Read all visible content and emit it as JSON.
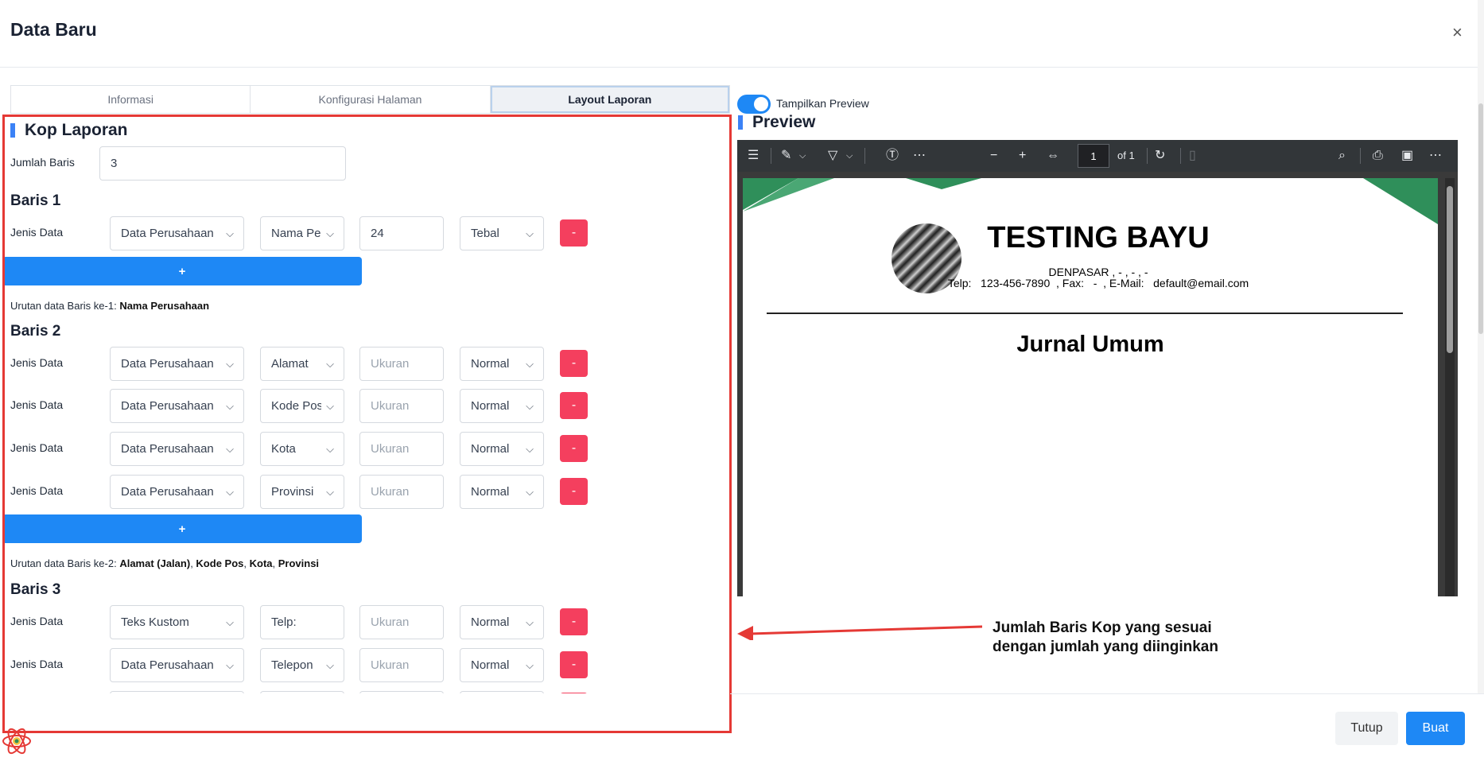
{
  "modal": {
    "title": "Data Baru",
    "close": "×"
  },
  "tabs": [
    {
      "label": "Informasi",
      "active": false
    },
    {
      "label": "Konfigurasi Halaman",
      "active": false
    },
    {
      "label": "Layout Laporan",
      "active": true
    }
  ],
  "kop": {
    "heading": "Kop Laporan",
    "jumlah_label": "Jumlah Baris",
    "jumlah_value": "3",
    "rows": [
      {
        "title": "Baris 1",
        "items": [
          {
            "label": "Jenis Data",
            "type": "Data Perusahaan",
            "field": "Nama Perusahaan",
            "size": "24",
            "size_placeholder": "",
            "style": "Tebal"
          }
        ],
        "plus": "+",
        "order_prefix": "Urutan data Baris ke-1:",
        "order_items": [
          "Nama Perusahaan"
        ]
      },
      {
        "title": "Baris 2",
        "items": [
          {
            "label": "Jenis Data",
            "type": "Data Perusahaan",
            "field": "Alamat",
            "size": "",
            "size_placeholder": "Ukuran",
            "style": "Normal"
          },
          {
            "label": "Jenis Data",
            "type": "Data Perusahaan",
            "field": "Kode Pos",
            "size": "",
            "size_placeholder": "Ukuran",
            "style": "Normal"
          },
          {
            "label": "Jenis Data",
            "type": "Data Perusahaan",
            "field": "Kota",
            "size": "",
            "size_placeholder": "Ukuran",
            "style": "Normal"
          },
          {
            "label": "Jenis Data",
            "type": "Data Perusahaan",
            "field": "Provinsi",
            "size": "",
            "size_placeholder": "Ukuran",
            "style": "Normal"
          }
        ],
        "plus": "+",
        "order_prefix": "Urutan data Baris ke-2:",
        "order_items": [
          "Alamat (Jalan)",
          "Kode Pos",
          "Kota",
          "Provinsi"
        ]
      },
      {
        "title": "Baris 3",
        "items": [
          {
            "label": "Jenis Data",
            "type": "Teks Kustom",
            "field": "Telp:",
            "size": "",
            "size_placeholder": "Ukuran",
            "style": "Normal"
          },
          {
            "label": "Jenis Data",
            "type": "Data Perusahaan",
            "field": "Telepon",
            "size": "",
            "size_placeholder": "Ukuran",
            "style": "Normal"
          }
        ]
      }
    ],
    "minus": "-"
  },
  "preview": {
    "toggle_label": "Tampilkan Preview",
    "toggle_on": true,
    "heading": "Preview",
    "viewer": {
      "page_value": "1",
      "page_of": "of 1"
    },
    "doc": {
      "company": "TESTING BAYU",
      "address": "DENPASAR , - , - , -",
      "contact": "Telp:   123-456-7890  , Fax:   -  , E-Mail:   default@email.com",
      "title": "Jurnal Umum"
    }
  },
  "annotation": {
    "line1": "Jumlah Baris Kop yang sesuai",
    "line2": "dengan jumlah yang diinginkan"
  },
  "footer": {
    "tutup": "Tutup",
    "buat": "Buat"
  },
  "colors": {
    "accent": "#1e88f5",
    "danger": "#f43f5e",
    "frame": "#e53935",
    "header_green": "#2f8f5a"
  }
}
